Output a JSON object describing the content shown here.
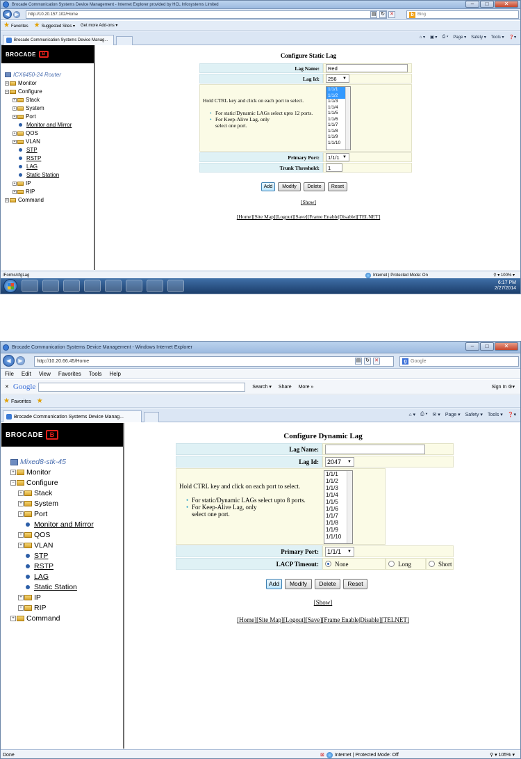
{
  "colors": {
    "brand_red": "#e0211b",
    "label_bg": "#dff1f5",
    "field_bg": "#fbfbe6",
    "selection": "#3399ff",
    "frame_blue": "#bcd3ee"
  },
  "shot1": {
    "window_title": "Brocade Communication Systems Device Management - Internet Explorer provided by HCL Infosystems Limited",
    "url": "http://10.20.157.102/Home",
    "search_placeholder": "Bing",
    "favorites": [
      "Favorites",
      "Suggested Sites ▾",
      "Get more Add-ons ▾"
    ],
    "tab_label": "Brocade Communication Systems Device Manag...",
    "command_bar": [
      "Page ▾",
      "Safety ▾",
      "Tools ▾"
    ],
    "brand": "BROCADE",
    "tree": {
      "root": "ICX6450-24 Router",
      "monitor": "Monitor",
      "configure": "Configure",
      "stack": "Stack",
      "system": "System",
      "port": "Port",
      "monitor_mirror": "Monitor and Mirror",
      "qos": "QOS",
      "vlan": "VLAN",
      "stp": "STP",
      "rstp": "RSTP",
      "lag": "LAG",
      "static_station": "Static Station",
      "ip": "IP",
      "rip": "RIP",
      "command": "Command"
    },
    "form": {
      "title": "Configure Static Lag",
      "lag_name_label": "Lag Name:",
      "lag_name_value": "Red",
      "lag_id_label": "Lag Id:",
      "lag_id_value": "256",
      "hold_ctrl": "Hold CTRL key and click on each port to select.",
      "bullet1": "For static/Dynamic LAGs select upto 12 ports.",
      "bullet2a": "For Keep-Alive Lag, only",
      "bullet2b": "select one port.",
      "ports": [
        "1/1/1",
        "1/1/2",
        "1/1/3",
        "1/1/4",
        "1/1/5",
        "1/1/6",
        "1/1/7",
        "1/1/8",
        "1/1/9",
        "1/1/10"
      ],
      "selected_ports": [
        "1/1/1",
        "1/1/2"
      ],
      "primary_port_label": "Primary Port:",
      "primary_port_value": "1/1/1",
      "trunk_threshold_label": "Trunk Threshold:",
      "trunk_threshold_value": "1"
    },
    "buttons": {
      "add": "Add",
      "modify": "Modify",
      "delete": "Delete",
      "reset": "Reset"
    },
    "show": "[Show]",
    "footer": "[Home][Site Map][Logout][Save][Frame Enable|Disable][TELNET]",
    "status_left": "/Forms/cfgLag",
    "status_zone": "Internet | Protected Mode: On",
    "zoom": "100%",
    "tray_time": "6:17 PM",
    "tray_date": "2/27/2014"
  },
  "shot2": {
    "window_title": "Brocade Communication Systems Device Management - Windows Internet Explorer",
    "url": "http://10.20.66.45/Home",
    "search_placeholder": "Google",
    "menu": [
      "File",
      "Edit",
      "View",
      "Favorites",
      "Tools",
      "Help"
    ],
    "google_bar": {
      "logo": "Google",
      "search": "Search ▾",
      "share": "Share",
      "more": "More »",
      "signin": "Sign In"
    },
    "favorites": [
      "Favorites"
    ],
    "tab_label": "Brocade Communication Systems Device Manag...",
    "command_bar": [
      "Page ▾",
      "Safety ▾",
      "Tools ▾"
    ],
    "brand": "BROCADE",
    "tree": {
      "root": "Mixed8-stk-45",
      "monitor": "Monitor",
      "configure": "Configure",
      "stack": "Stack",
      "system": "System",
      "port": "Port",
      "monitor_mirror": "Monitor and Mirror",
      "qos": "QOS",
      "vlan": "VLAN",
      "stp": "STP",
      "rstp": "RSTP",
      "lag": "LAG",
      "static_station": "Static Station",
      "ip": "IP",
      "rip": "RIP",
      "command": "Command"
    },
    "form": {
      "title": "Configure Dynamic Lag",
      "lag_name_label": "Lag Name:",
      "lag_name_value": "",
      "lag_id_label": "Lag Id:",
      "lag_id_value": "2047",
      "hold_ctrl": "Hold CTRL key and click on each port to select.",
      "bullet1": "For static/Dynamic LAGs select upto 8 ports.",
      "bullet2a": "For Keep-Alive Lag, only",
      "bullet2b": "select one port.",
      "ports": [
        "1/1/1",
        "1/1/2",
        "1/1/3",
        "1/1/4",
        "1/1/5",
        "1/1/6",
        "1/1/7",
        "1/1/8",
        "1/1/9",
        "1/1/10"
      ],
      "primary_port_label": "Primary Port:",
      "primary_port_value": "1/1/1",
      "lacp_label": "LACP Timeout:",
      "lacp_options": [
        "None",
        "Long",
        "Short"
      ],
      "lacp_selected": "None"
    },
    "buttons": {
      "add": "Add",
      "modify": "Modify",
      "delete": "Delete",
      "reset": "Reset"
    },
    "show": "[Show]",
    "footer": "[Home][Site Map][Logout][Save][Frame Enable|Disable][TELNET]",
    "status_left": "Done",
    "status_zone": "Internet | Protected Mode: Off",
    "zoom": "105%"
  }
}
